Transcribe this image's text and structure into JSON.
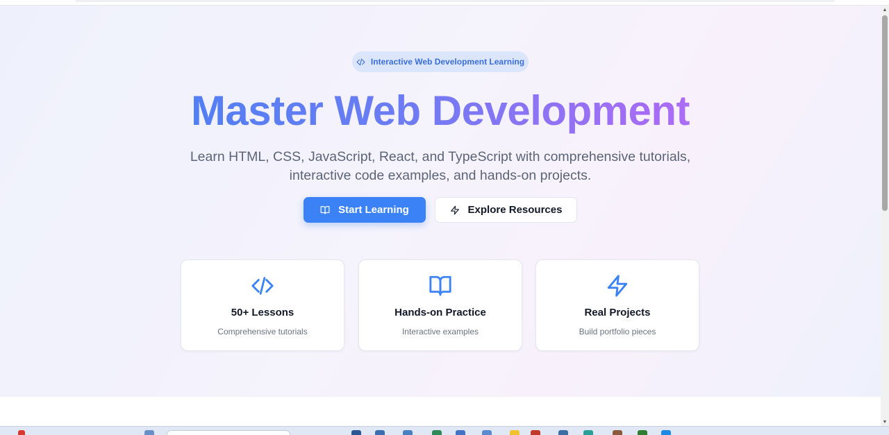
{
  "colors": {
    "accent": "#3b82f6",
    "gradient_start": "#3b82f6",
    "gradient_end": "#c084fc",
    "icon": "#3b82f6"
  },
  "hero": {
    "badge": {
      "icon": "code-icon",
      "label": "Interactive Web Development Learning"
    },
    "title": "Master Web Development",
    "subtitle": "Learn HTML, CSS, JavaScript, React, and TypeScript with comprehensive tutorials, interactive code examples, and hands-on projects.",
    "primary_button": {
      "icon": "book-open-icon",
      "label": "Start Learning"
    },
    "secondary_button": {
      "icon": "zap-icon",
      "label": "Explore Resources"
    }
  },
  "features": [
    {
      "icon": "code-icon",
      "title": "50+ Lessons",
      "description": "Comprehensive tutorials"
    },
    {
      "icon": "book-open-icon",
      "title": "Hands-on Practice",
      "description": "Interactive examples"
    },
    {
      "icon": "zap-icon",
      "title": "Real Projects",
      "description": "Build portfolio pieces"
    }
  ]
}
